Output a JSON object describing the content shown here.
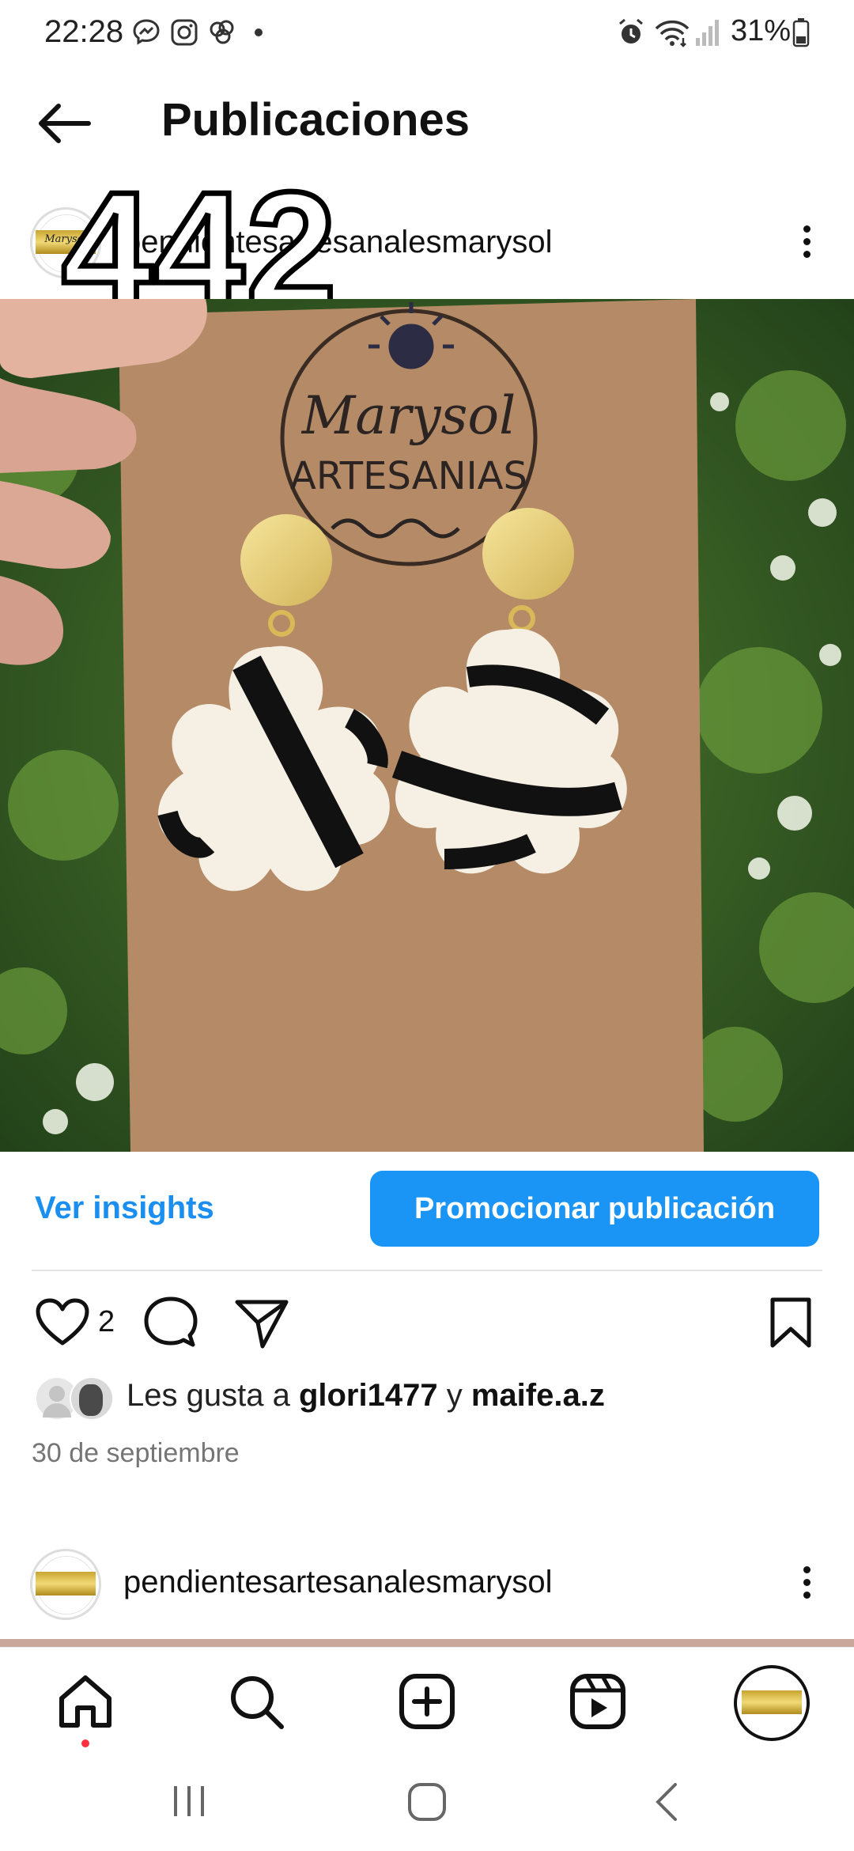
{
  "status_bar": {
    "time": "22:28",
    "battery": "31%",
    "icons": [
      "messenger-icon",
      "instagram-icon",
      "threads-icon",
      "dot-icon",
      "alarm-icon",
      "wifi-icon",
      "signal-icon",
      "battery-icon"
    ]
  },
  "header": {
    "title": "Publicaciones",
    "back_icon": "back-arrow-icon"
  },
  "overlay_number": "442",
  "post": {
    "username": "pendientesartesanalesmarysol",
    "avatar_text": "Marysol",
    "photo_card_text": {
      "brand": "Marysol",
      "subtitle": "ARTESANIAS"
    },
    "insights_label": "Ver insights",
    "promote_label": "Promocionar publicación",
    "like_count": "2",
    "likes_prefix": "Les gusta a",
    "likes_user1": "glori1477",
    "likes_joiner": "y",
    "likes_user2": "maife.a.z",
    "date": "30 de septiembre",
    "action_icons": [
      "heart-icon",
      "comment-icon",
      "share-icon",
      "bookmark-icon"
    ]
  },
  "next_post": {
    "username": "pendientesartesanalesmarysol"
  },
  "bottom_nav": {
    "items": [
      "home-icon",
      "search-icon",
      "create-icon",
      "reels-icon",
      "profile-avatar"
    ],
    "notification_color": "#ff3040"
  },
  "system_nav": [
    "recents-icon",
    "home-circle-icon",
    "back-chevron-icon"
  ],
  "colors": {
    "accent": "#1a94f5",
    "link": "#1a8ff0"
  }
}
